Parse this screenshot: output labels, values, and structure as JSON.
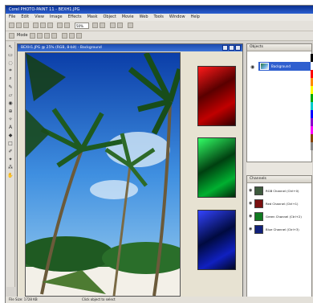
{
  "app": {
    "title": "Corel PHOTO-PAINT 11 - BEXH1.JPG"
  },
  "menu": [
    "File",
    "Edit",
    "View",
    "Image",
    "Effects",
    "Mask",
    "Object",
    "Movie",
    "Web",
    "Tools",
    "Window",
    "Help"
  ],
  "toolbar": {
    "zoom_value": "50%",
    "mode_label": "Mode"
  },
  "document": {
    "title": "BEXH1.JPG @ 25% (RGB, 8-bit) - Background"
  },
  "objects_panel": {
    "title": "Objects",
    "items": [
      {
        "label": "Background"
      }
    ]
  },
  "channels_panel": {
    "title": "Channels",
    "items": [
      {
        "label": "RGB Channel (Ctrl+0)",
        "color": "#3d5a3d"
      },
      {
        "label": "Red Channel (Ctrl+1)",
        "color": "#7a1010"
      },
      {
        "label": "Green Channel (Ctrl+2)",
        "color": "#107a20"
      },
      {
        "label": "Blue Channel (Ctrl+3)",
        "color": "#10207a"
      }
    ]
  },
  "status": {
    "size": "File Size: 1728 KB",
    "hint": "Click object to select"
  },
  "colors": {
    "accent": "#2f5fcf",
    "red_channel": "#c01010",
    "green_channel": "#10b040",
    "blue_channel": "#1020c0"
  }
}
